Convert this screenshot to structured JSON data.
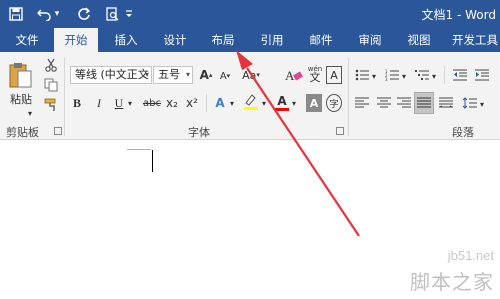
{
  "titlebar": {
    "save_icon": "save-icon",
    "undo_icon": "undo-icon",
    "redo_icon": "refresh-icon",
    "print_preview_icon": "print-preview-icon",
    "customize_icon": "dropdown-icon",
    "title": "文档1 - Word"
  },
  "tabs": [
    "文件",
    "开始",
    "插入",
    "设计",
    "布局",
    "引用",
    "邮件",
    "审阅",
    "视图",
    "开发工具"
  ],
  "active_tab": "开始",
  "clipboard": {
    "paste_label": "粘贴",
    "group_label": "剪贴板"
  },
  "font": {
    "font_name": "等线 (中文正文",
    "font_size": "五号",
    "group_label": "字体",
    "bold": "B",
    "italic": "I",
    "underline": "U",
    "strike": "abc",
    "subscript": "x₂",
    "superscript": "x²",
    "grow": "A",
    "shrink": "A",
    "case": "Aa",
    "phonetic": "wén",
    "highlight_color": "#ffff00",
    "font_color": "#ff0000"
  },
  "paragraph": {
    "group_label": "段落"
  },
  "watermark": {
    "line1": "jb51.net",
    "line2": "脚本之家"
  },
  "colors": {
    "titlebar": "#2b579a",
    "ribbon": "#f3f3f3",
    "arrow": "#e8333c"
  }
}
